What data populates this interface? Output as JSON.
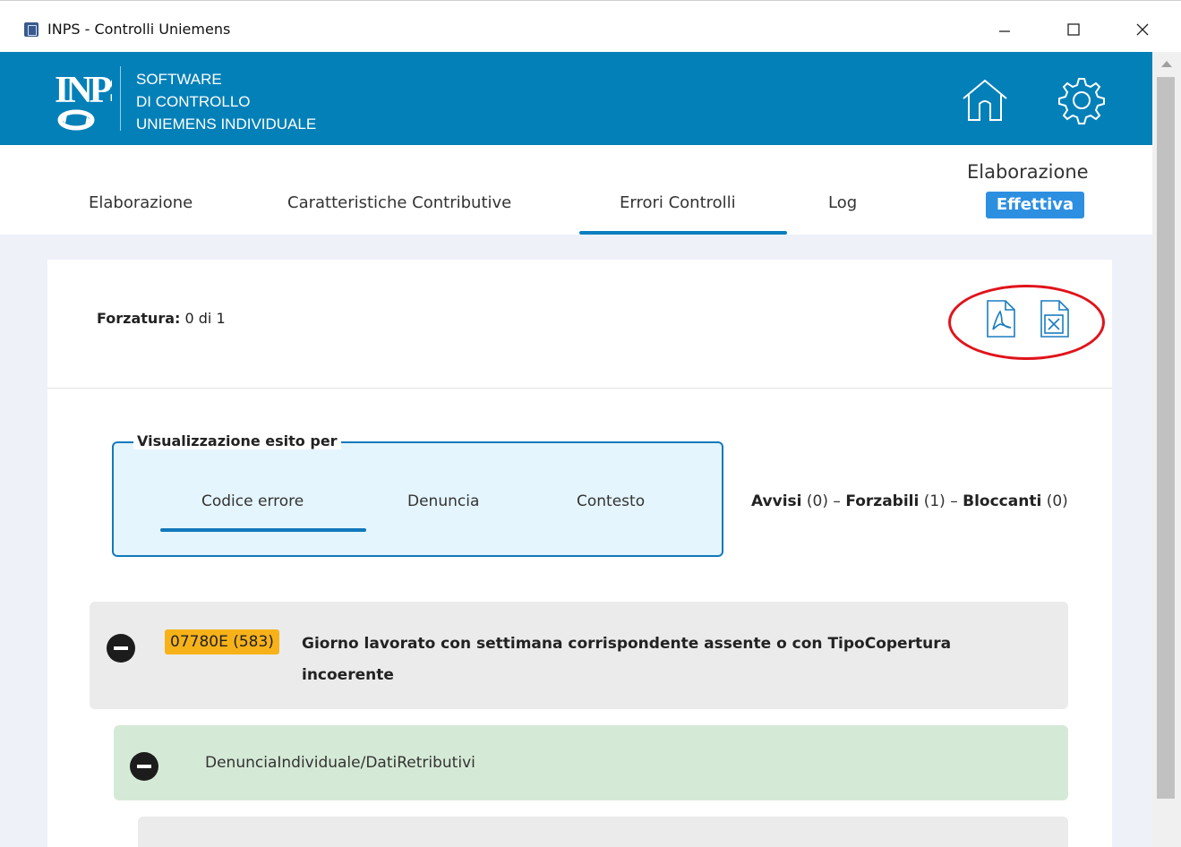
{
  "window": {
    "title": "INPS - Controlli Uniemens",
    "icon": "app-icon"
  },
  "header": {
    "brand_line1": "SOFTWARE",
    "brand_line2": "DI CONTROLLO",
    "brand_line3": "UNIEMENS INDIVIDUALE",
    "logo_text": "INPS",
    "icons": [
      "home-icon",
      "gear-icon"
    ],
    "background_color": "#0480b8"
  },
  "nav": {
    "tabs": [
      {
        "label": "Elaborazione"
      },
      {
        "label": "Caratteristiche Contributive"
      },
      {
        "label": "Errori Controlli",
        "active": true
      },
      {
        "label": "Log"
      }
    ],
    "elaborazione_label": "Elaborazione",
    "elaborazione_badge": "Effettiva"
  },
  "card": {
    "forzatura_label": "Forzatura:",
    "forzatura_value": "0 di 1",
    "export_icons": [
      "pdf-icon",
      "excel-icon"
    ],
    "highlight_color": "#e0141b"
  },
  "view_by": {
    "legend": "Visualizzazione esito per",
    "tabs": [
      {
        "label": "Codice errore",
        "active": true
      },
      {
        "label": "Denuncia"
      },
      {
        "label": "Contesto"
      }
    ]
  },
  "summary": {
    "avvisi_label": "Avvisi",
    "avvisi_count": "(0)",
    "sep1": "–",
    "forzabili_label": "Forzabili",
    "forzabili_count": "(1)",
    "sep2": "–",
    "bloccanti_label": "Bloccanti",
    "bloccanti_count": "(0)"
  },
  "errors": [
    {
      "code": "07780E (583)",
      "description": "Giorno lavorato con settimana corrispondente assente o con TipoCopertura incoerente",
      "code_color": "#f7b21a",
      "contexts": [
        {
          "path": "DenunciaIndividuale/DatiRetributivi",
          "color": "#d5ead6"
        }
      ]
    }
  ]
}
